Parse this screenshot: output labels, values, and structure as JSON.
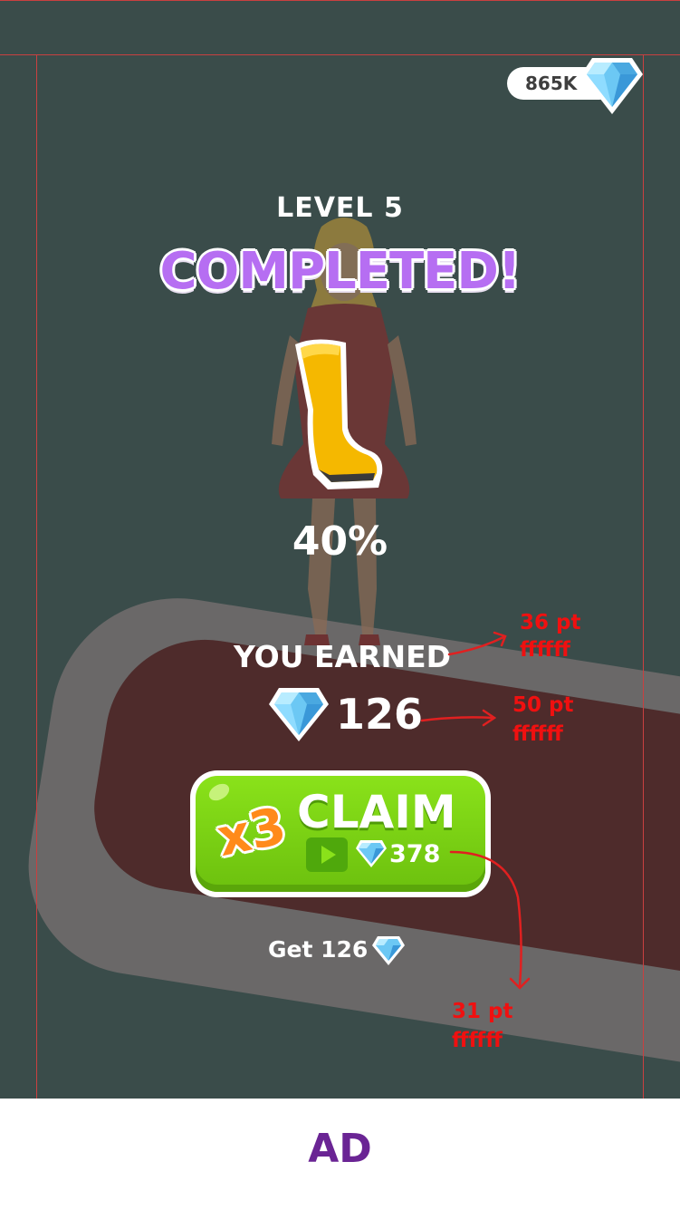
{
  "currency": {
    "balance": "865K",
    "icon": "diamond-icon"
  },
  "level": {
    "label": "LEVEL 5",
    "status": "COMPLETED!"
  },
  "unlock": {
    "item_icon": "boot-icon",
    "progress_text": "40%",
    "progress": 0.4
  },
  "reward": {
    "earned_label": "YOU EARNED",
    "earned_value": "126",
    "claim": {
      "multiplier": "x3",
      "label": "CLAIM",
      "value": "378",
      "video_icon": "play-icon"
    },
    "skip_label": "Get 126"
  },
  "annotations": [
    {
      "size": "36 pt",
      "color": "ffffff"
    },
    {
      "size": "50 pt",
      "color": "ffffff"
    },
    {
      "size": "31 pt",
      "color": "ffffff"
    }
  ],
  "ad": {
    "label": "AD"
  },
  "colors": {
    "background": "#3a4c4a",
    "completed": "#b66ef2",
    "claim_button": "#7fd816",
    "multiplier": "#ff8a1a",
    "annotation": "#f01010",
    "ad_text": "#6a2494"
  }
}
